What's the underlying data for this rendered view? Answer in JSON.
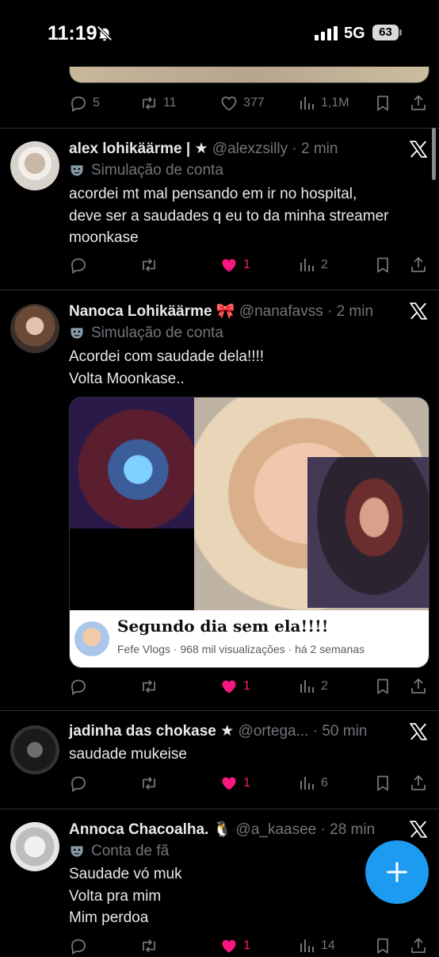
{
  "status_bar": {
    "time": "11:19",
    "network": "5G",
    "battery": "63"
  },
  "top_tweet": {
    "replies": "5",
    "retweets": "11",
    "likes": "377",
    "views": "1,1M"
  },
  "tweets": [
    {
      "name": "alex lohikäärme | ★",
      "handle": "@alexzsilly · 2 min",
      "label": "Simulação de conta",
      "lines": [
        "acordei mt mal pensando em ir no hospital,",
        "deve ser a saudades q eu to da minha streamer",
        "moonkase"
      ],
      "likes": "1",
      "views": "2"
    },
    {
      "name": "Nanoca Lohikäärme 🎀",
      "handle": "@nanafavss · 2 min",
      "label": "Simulação de conta",
      "lines": [
        "Acordei com saudade dela!!!!",
        "Volta Moonkase.."
      ],
      "card_title": "Segundo dia sem ela!!!!",
      "card_sub": "Fefe Vlogs · 968 mil visualizações · há 2 semanas",
      "likes": "1",
      "views": "2"
    },
    {
      "name": "jadinha das chokase ★",
      "handle": "@ortega... · 50 min",
      "lines": [
        "saudade mukeise"
      ],
      "likes": "1",
      "views": "6"
    },
    {
      "name": "Annoca Chacoalha. 🐧",
      "handle": "@a_kaasee · 28 min",
      "label": "Conta de fã",
      "lines": [
        "Saudade vó muk",
        "Volta pra mim",
        "Mim perdoa"
      ],
      "likes": "1",
      "views": "14"
    }
  ],
  "colors": {
    "accent": "#1d9bf0",
    "like": "#f91880",
    "muted": "#71767b"
  }
}
